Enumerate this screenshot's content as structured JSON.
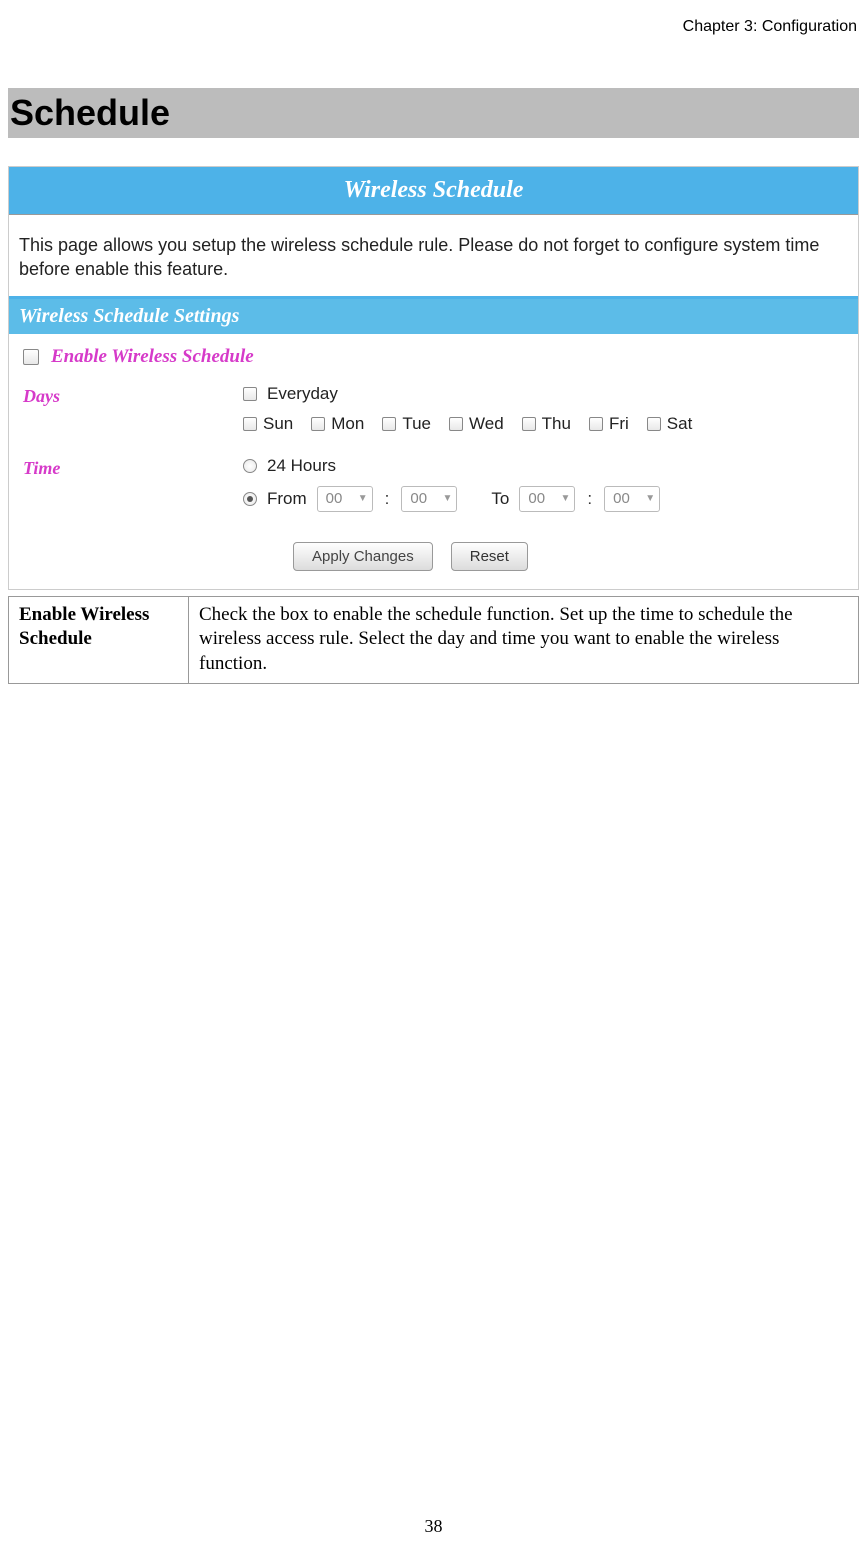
{
  "chapter_header": "Chapter 3: Configuration",
  "section_title": "Schedule",
  "panel": {
    "title": "Wireless Schedule",
    "description": "This page allows you setup the wireless schedule rule. Please do not forget to configure system time before enable this feature.",
    "section_header": "Wireless Schedule Settings",
    "enable_label": "Enable Wireless Schedule",
    "days_label": "Days",
    "everyday_label": "Everyday",
    "days": [
      "Sun",
      "Mon",
      "Tue",
      "Wed",
      "Thu",
      "Fri",
      "Sat"
    ],
    "time_label": "Time",
    "twentyfour_label": "24 Hours",
    "from_label": "From",
    "to_label": "To",
    "from_hour": "00",
    "from_min": "00",
    "to_hour": "00",
    "to_min": "00",
    "apply_button": "Apply Changes",
    "reset_button": "Reset"
  },
  "desc_table": {
    "key": "Enable Wireless Schedule",
    "value": "Check the box to enable the schedule function. Set up the time to schedule the wireless access rule. Select the day and time you want to enable the wireless function."
  },
  "page_number": "38"
}
